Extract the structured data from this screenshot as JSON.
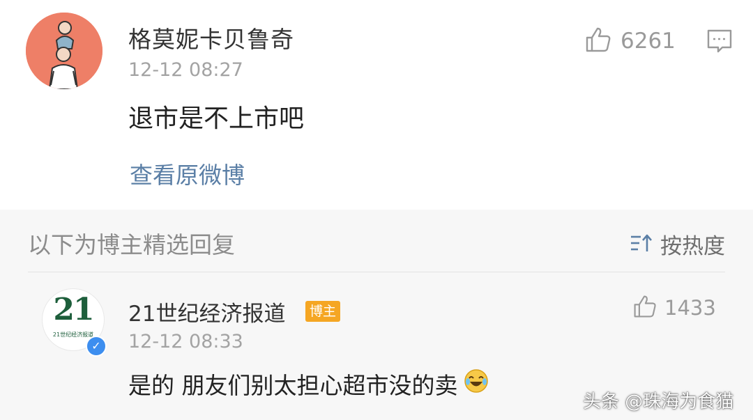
{
  "post": {
    "username": "格莫妮卡贝鲁奇",
    "timestamp": "12-12 08:27",
    "text": "退市是不上市吧",
    "view_original": "查看原微博",
    "like_count": "6261",
    "like_icon": "thumbs-up-icon",
    "comment_icon": "comment-icon",
    "avatar_bg": "#ee7f67"
  },
  "replies_section": {
    "heading": "以下为博主精选回复",
    "sort_label": "按热度",
    "sort_icon": "sort-icon",
    "accent": "#5b7fa6"
  },
  "reply": {
    "username": "21世纪经济报道",
    "author_badge": "博主",
    "timestamp": "12-12 08:33",
    "text": "是的 朋友们别太担心超市没的卖",
    "emoji": "laughing-crying-emoji",
    "like_count": "1433",
    "avatar_text": "21",
    "avatar_subtext": "21世纪经济报道",
    "verified_mark": "✓",
    "badge_color": "#f5a623",
    "verified_color": "#3d8eef"
  },
  "watermark": "头条 @珠海为食猫"
}
